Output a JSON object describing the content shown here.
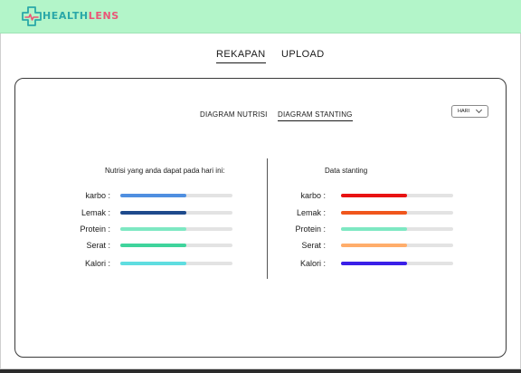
{
  "app": {
    "name_part1": "HEALTH",
    "name_part2": "LENS"
  },
  "nav": {
    "tabs": [
      {
        "label": "REKAPAN",
        "active": true
      },
      {
        "label": "UPLOAD",
        "active": false
      }
    ]
  },
  "subtabs": [
    {
      "label": "DIAGRAM NUTRISI",
      "active": false
    },
    {
      "label": "DIAGRAM STANTING",
      "active": true
    }
  ],
  "period_select": {
    "value": "HARI"
  },
  "nutrition": {
    "title": "Nutrisi yang anda dapat pada hari ini:",
    "rows": [
      {
        "label": "karbo :",
        "fraction": 0.59,
        "color": "#4f8fe0"
      },
      {
        "label": "Lemak :",
        "fraction": 0.59,
        "color": "#1e4a8c"
      },
      {
        "label": "Protein :",
        "fraction": 0.59,
        "color": "#7ee8c3"
      },
      {
        "label": "Serat :",
        "fraction": 0.59,
        "color": "#3fd49c"
      },
      {
        "label": "Kalori :",
        "fraction": 0.59,
        "color": "#5fdde0"
      }
    ]
  },
  "stunting": {
    "title": "Data stanting",
    "rows": [
      {
        "label": "karbo :",
        "fraction": 0.59,
        "color": "#e81212"
      },
      {
        "label": "Lemak :",
        "fraction": 0.59,
        "color": "#f0561c"
      },
      {
        "label": "Protein :",
        "fraction": 0.59,
        "color": "#7ee8c3"
      },
      {
        "label": "Serat :",
        "fraction": 0.59,
        "color": "#ffad6b"
      },
      {
        "label": "Kalori :",
        "fraction": 0.59,
        "color": "#3a1fe8"
      }
    ]
  },
  "colors": {
    "header_bg": "#b3f5c9",
    "logo_teal": "#2aa8a8",
    "logo_pink": "#ea5577"
  }
}
